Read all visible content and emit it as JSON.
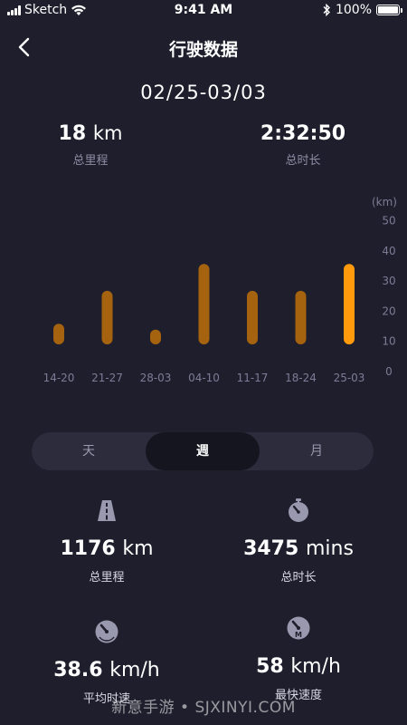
{
  "status_bar": {
    "carrier": "Sketch",
    "time": "9:41 AM",
    "battery": "100%"
  },
  "header": {
    "title": "行驶数据"
  },
  "date_range": "02/25-03/03",
  "summary": {
    "distance_value": "18",
    "distance_unit": "km",
    "distance_label": "总里程",
    "duration_value": "2:32:50",
    "duration_label": "总时长"
  },
  "chart_data": {
    "type": "bar",
    "categories": [
      "14-20",
      "21-27",
      "28-03",
      "04-10",
      "11-17",
      "18-24",
      "25-03"
    ],
    "values": [
      16,
      27,
      14,
      36,
      27,
      27,
      36
    ],
    "ylabel": "(km)",
    "yticks": [
      "0",
      "10",
      "20",
      "30",
      "40",
      "50"
    ],
    "ylim": [
      0,
      50
    ],
    "highlight_index": 6,
    "colors": {
      "bar": "#a5620f",
      "highlight": "#ff9a0c"
    }
  },
  "segmented": {
    "options": [
      "天",
      "週",
      "月"
    ],
    "active_index": 1
  },
  "stats": {
    "total_distance": {
      "value": "1176",
      "unit": "km",
      "label": "总里程",
      "icon": "road-icon"
    },
    "total_time": {
      "value": "3475",
      "unit": "mins",
      "label": "总时长",
      "icon": "stopwatch-icon"
    },
    "avg_speed": {
      "value": "38.6",
      "unit": "km/h",
      "label": "平均时速",
      "icon": "speedometer-icon"
    },
    "max_speed": {
      "value": "58",
      "unit": "km/h",
      "label": "最快速度",
      "icon": "max-speed-icon"
    }
  },
  "watermark": "新意手游 • SJXINYI.COM"
}
